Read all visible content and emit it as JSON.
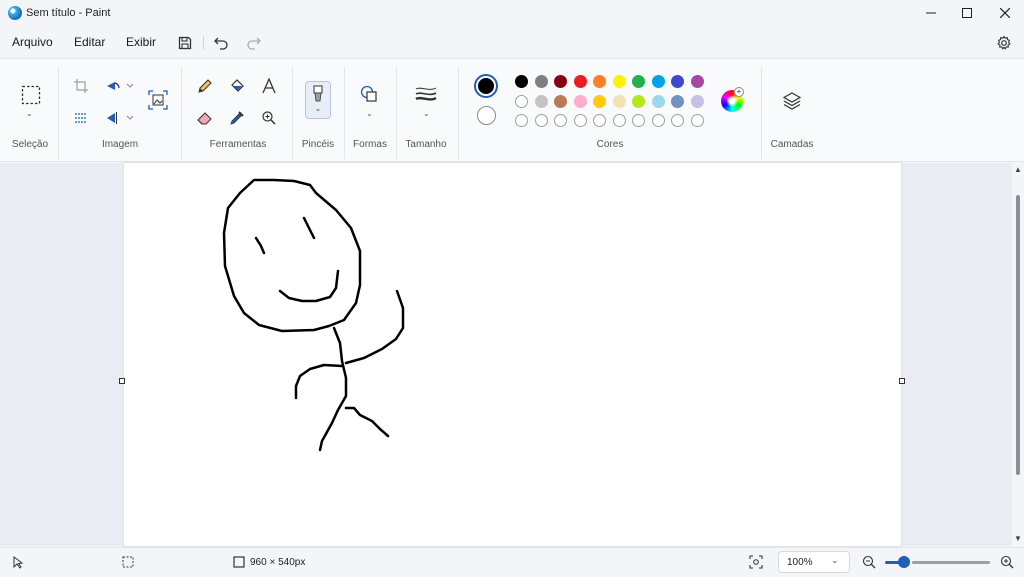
{
  "window": {
    "title": "Sem título - Paint"
  },
  "menu": {
    "file": "Arquivo",
    "edit": "Editar",
    "view": "Exibir"
  },
  "ribbon": {
    "groups": {
      "selection": "Seleção",
      "image": "Imagem",
      "tools": "Ferramentas",
      "brushes": "Pincéis",
      "shapes": "Formas",
      "size": "Tamanho",
      "colors": "Cores",
      "layers": "Camadas"
    },
    "colors": {
      "primary": "#000000",
      "secondary": "#ffffff",
      "row1": [
        "#000000",
        "#7f7f7f",
        "#880015",
        "#ed1c24",
        "#ff7f27",
        "#fff200",
        "#22b14c",
        "#00a2e8",
        "#3f48cc",
        "#a349a4"
      ],
      "row2": [
        "#ffffff",
        "#c3c3c3",
        "#b97a57",
        "#ffaec9",
        "#ffc90e",
        "#efe4b0",
        "#b5e61d",
        "#99d9ea",
        "#7092be",
        "#c8bfe7"
      ]
    }
  },
  "status": {
    "canvas_size": "960 × 540px",
    "zoom": "100%"
  }
}
